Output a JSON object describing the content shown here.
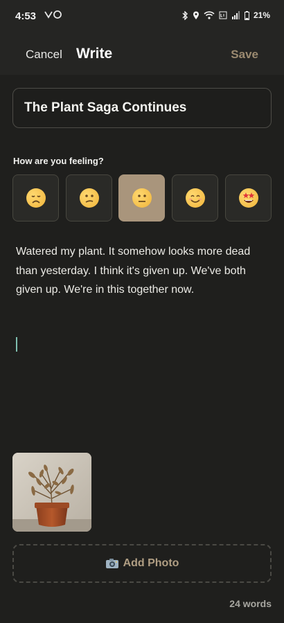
{
  "status": {
    "time": "4:53",
    "battery": "21%",
    "left_icons": "⚖ ○",
    "right_icons": [
      "bluetooth-icon",
      "location-icon",
      "wifi-icon",
      "lte-icon",
      "signal-icon",
      "battery-icon"
    ]
  },
  "header": {
    "cancel": "Cancel",
    "title": "Write",
    "save": "Save",
    "accent": "#9b8a70"
  },
  "entry": {
    "title": "The Plant Saga Continues",
    "body": "Watered my plant. It somehow looks more dead than yesterday. I think it's given up. We've both given up. We're in this together now."
  },
  "mood": {
    "label": "How are you feeling?",
    "options": [
      "very-sad",
      "sad",
      "neutral",
      "happy",
      "excited"
    ],
    "selected": "neutral",
    "selected_color": "#a9957c"
  },
  "photo": {
    "subject": "withered-potted-plant"
  },
  "add_photo": {
    "label": "Add Photo",
    "icon": "camera-icon"
  },
  "word_count": "24 words"
}
